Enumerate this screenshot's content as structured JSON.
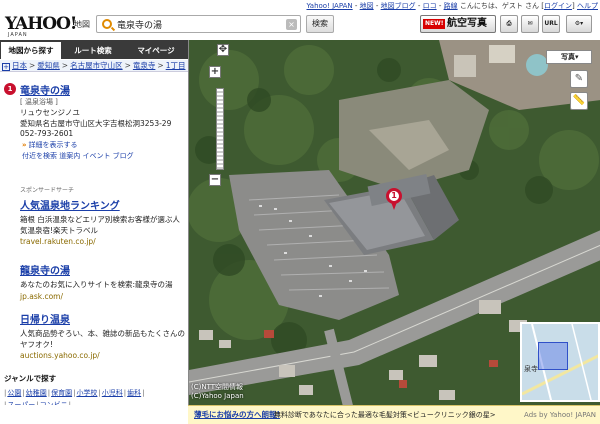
{
  "top_links": {
    "items": [
      "Yahoo! JAPAN",
      "地図",
      "地図ブログ",
      "ロコ",
      "路線"
    ],
    "greeting_prefix": "こんにちは、",
    "user": "ゲスト",
    "greeting_suffix": "さん",
    "login": "ログイン",
    "help": "ヘルプ"
  },
  "header": {
    "logo": "YAHOO!",
    "logo_sub": "JAPAN",
    "service": "地図",
    "search_value": "竜泉寺の湯",
    "clear": "×",
    "search_button": "検索",
    "new_badge": "NEW!",
    "aerial_button": "航空写真",
    "print_label": "⎙",
    "mail_label": "✉",
    "url_label": "URL",
    "gear_label": "⚙▾"
  },
  "tabs": [
    "地図から探す",
    "ルート検索",
    "マイページ"
  ],
  "breadcrumb": {
    "plus": "+",
    "items": [
      "日本",
      "愛知県",
      "名古屋市守山区",
      "竜泉寺",
      "1丁目"
    ],
    "sep": ">"
  },
  "result": {
    "number": "1",
    "title": "竜泉寺の湯",
    "category": "[ 温泉浴場 ]",
    "kana": "リュウセンジノユ",
    "address": "愛知県名古屋市守山区大字吉根松洞3253-29",
    "tel": "052-793-2601",
    "detail_arrow": "»",
    "detail": "詳細を表示する",
    "links": "付近を検索 道案内 イベント ブログ"
  },
  "sponsor_label": "スポンサードサーチ",
  "ads": [
    {
      "title": "人気温泉地ランキング",
      "desc": "箱根 白浜温泉などエリア別検索お客様が選ぶ人気温泉宿!楽天トラベル",
      "url": "travel.rakuten.co.jp/"
    },
    {
      "title": "龍泉寺の湯",
      "desc": "あなたのお気に入りサイトを検索:龍泉寺の湯",
      "url": "jp.ask.com/"
    },
    {
      "title": "日帰り温泉",
      "desc": "人気商品勢ぞろい、本、雑誌の新品もたくさんのヤフオク!",
      "url": "auctions.yahoo.co.jp/"
    }
  ],
  "genre": {
    "title": "ジャンルで探す",
    "items": [
      "公園",
      "幼稚園",
      "保育園",
      "小学校",
      "小児科",
      "歯科",
      "スーパー",
      "コンビニ"
    ]
  },
  "map": {
    "zoom_in": "+",
    "zoom_out": "−",
    "move": "✥",
    "layer_button": "写真",
    "layer_arrow": "▾",
    "pin": "1",
    "copyright_1": "(C)NTT空間情報",
    "copyright_2": "(C)Yahoo Japan",
    "minimap_label": "泉寺"
  },
  "bottom_ad": {
    "link": "薄毛にお悩みの方へ朗報!",
    "text": "無料診断であなたに合った最適な毛髪対策<ビュークリニック銀の星>",
    "source": "Ads by Yahoo! JAPAN"
  },
  "colors": {
    "link": "#1a3ea8",
    "accent": "#c8102e",
    "tab_bar": "#3a3a3a"
  }
}
